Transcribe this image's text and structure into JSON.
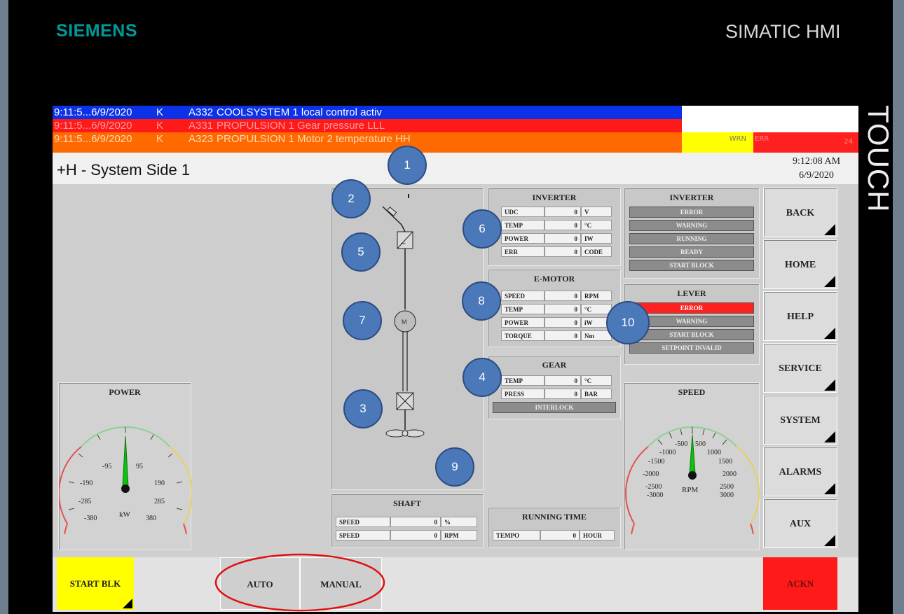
{
  "brand": {
    "left": "SIEMENS",
    "right": "SIMATIC HMI",
    "side": "TOUCH"
  },
  "alarms": [
    {
      "time": "9:11:5...6/9/2020",
      "status": "K",
      "code": "A332",
      "text": "COOLSYSTEM 1 local control activ",
      "color": "#0b32e8",
      "text_color": "#ffffff"
    },
    {
      "time": "9:11:5...6/9/2020",
      "status": "K",
      "code": "A331",
      "text": "PROPULSION 1 Gear pressure LLL",
      "color": "#ff1a1a",
      "text_color": "#ff9b9b"
    },
    {
      "time": "9:11:5...6/9/2020",
      "status": "K",
      "code": "A323",
      "text": "PROPULSION 1 Motor 2 temperature HH",
      "color": "#ff6a00",
      "text_color": "#ffd9b8"
    }
  ],
  "indicators": {
    "wrn": "WRN",
    "err": "ERR",
    "err_count": "24"
  },
  "header": {
    "title": "+H - System Side 1",
    "time": "9:12:08 AM",
    "date": "6/9/2020"
  },
  "inverter": {
    "title": "INVERTER",
    "rows": [
      {
        "label": "UDC",
        "value": "0",
        "unit": "V"
      },
      {
        "label": "TEMP",
        "value": "0",
        "unit": "°C"
      },
      {
        "label": "POWER",
        "value": "0",
        "unit": "IW"
      },
      {
        "label": "ERR",
        "value": "0",
        "unit": "CODE"
      }
    ]
  },
  "inverter_status": {
    "title": "INVERTER",
    "items": [
      "ERROR",
      "WARNING",
      "RUNNING",
      "READY",
      "START BLOCK"
    ]
  },
  "emotor": {
    "title": "E-MOTOR",
    "rows": [
      {
        "label": "SPEED",
        "value": "0",
        "unit": "RPM"
      },
      {
        "label": "TEMP",
        "value": "0",
        "unit": "°C"
      },
      {
        "label": "POWER",
        "value": "0",
        "unit": "iW"
      },
      {
        "label": "TORQUE",
        "value": "0",
        "unit": "Nm"
      }
    ]
  },
  "lever": {
    "title": "LEVER",
    "items": [
      "ERROR",
      "WARNING",
      "START BLOCK",
      "SETPOINT INVALID"
    ]
  },
  "gear": {
    "title": "GEAR",
    "rows": [
      {
        "label": "TEMP",
        "value": "0",
        "unit": "°C"
      },
      {
        "label": "PRESS",
        "value": "0",
        "unit": "BAR"
      }
    ],
    "interlock": "INTERLOCK"
  },
  "shaft": {
    "title": "SHAFT",
    "rows": [
      {
        "label": "SPEED",
        "value": "0",
        "unit": "%"
      },
      {
        "label": "SPEED",
        "value": "0",
        "unit": "RPM"
      }
    ]
  },
  "running_time": {
    "title": "RUNNING TIME",
    "label": "TEMPO",
    "value": "0",
    "unit": "HOUR"
  },
  "power_gauge": {
    "title": "POWER",
    "unit": "kW",
    "ticks": [
      "-95",
      "95",
      "-190",
      "190",
      "-285",
      "285",
      "-380",
      "380"
    ],
    "value": 0
  },
  "speed_gauge": {
    "title": "SPEED",
    "unit": "RPM",
    "ticks": [
      "-500",
      "500",
      "-1000",
      "1000",
      "-1500",
      "1500",
      "-2000",
      "2000",
      "-2500",
      "2500",
      "-3000",
      "3000"
    ],
    "value": 0
  },
  "nav": [
    "BACK",
    "HOME",
    "HELP",
    "SERVICE",
    "SYSTEM",
    "ALARMS",
    "AUX"
  ],
  "bottom": {
    "start_blk": "START BLK",
    "auto": "AUTO",
    "manual": "MANUAL",
    "ackn": "ACKN"
  },
  "markers": [
    "1",
    "2",
    "5",
    "6",
    "7",
    "8",
    "10",
    "4",
    "3",
    "9"
  ],
  "colors": {
    "start_blk": "#ffff00",
    "ackn": "#ff1a1a",
    "marker": "#4a78b8",
    "annotation_ring": "#e01010",
    "siemens": "#009999"
  }
}
